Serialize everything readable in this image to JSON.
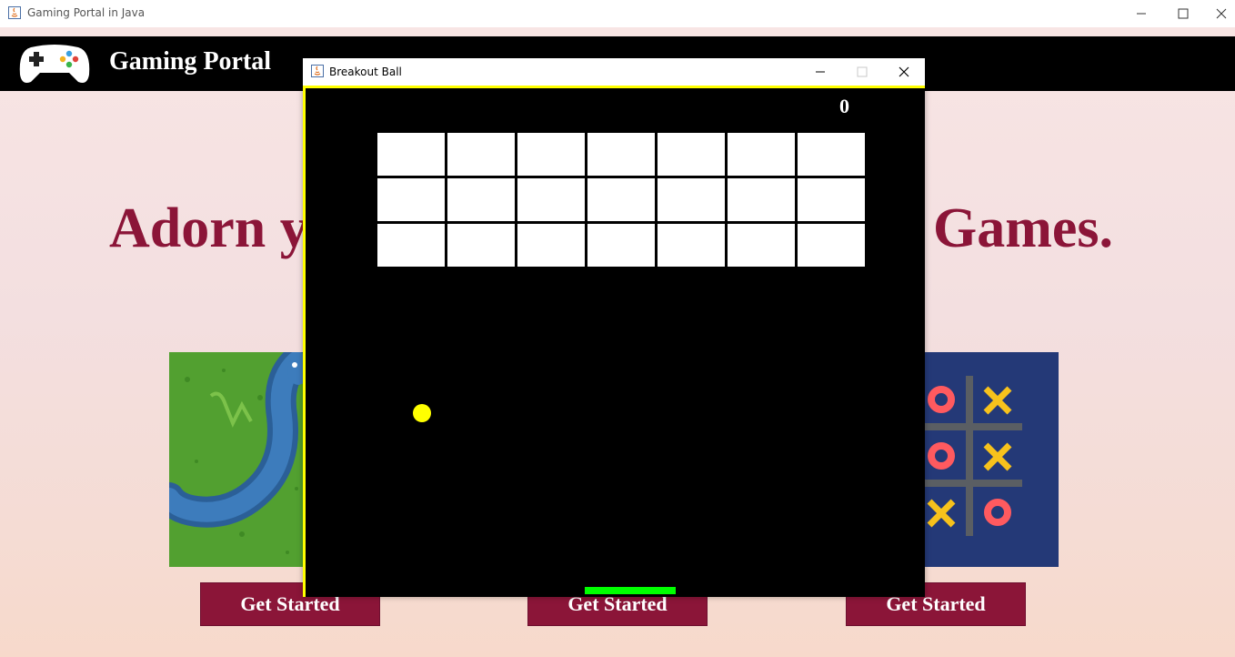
{
  "window": {
    "title": "Gaming Portal in Java",
    "controls": [
      "minimize-icon",
      "maximize-icon",
      "close-icon"
    ]
  },
  "portal": {
    "title": "Gaming Portal",
    "headline_left": "Adorn y",
    "headline_right": "Games.",
    "buttons": [
      {
        "label": "Get Started"
      },
      {
        "label": "Get Started"
      },
      {
        "label": "Get Started"
      }
    ],
    "colors": {
      "accent": "#8b1538",
      "header": "#000000"
    }
  },
  "game_window": {
    "title": "Breakout Ball",
    "score": "0",
    "bricks": {
      "rows": 3,
      "cols": 7,
      "color": "#ffffff"
    },
    "ball_color": "#ffff00",
    "paddle_color": "#00ff00",
    "border_color": "#ffff00"
  }
}
